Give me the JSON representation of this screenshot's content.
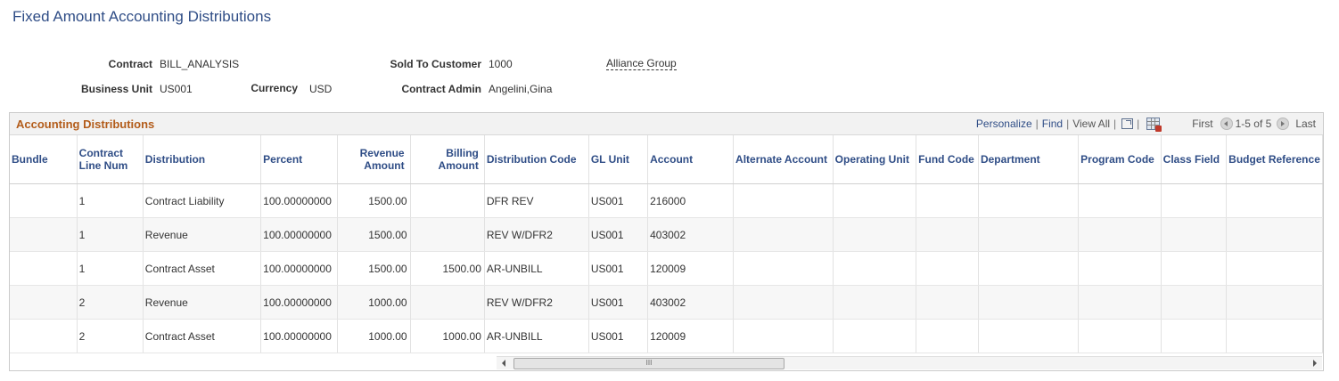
{
  "page": {
    "title": "Fixed Amount Accounting Distributions"
  },
  "header": {
    "contract_label": "Contract",
    "contract_value": "BILL_ANALYSIS",
    "sold_to_label": "Sold To Customer",
    "sold_to_value": "1000",
    "sold_to_name": "Alliance Group",
    "bu_label": "Business Unit",
    "bu_value": "US001",
    "currency_label": "Currency",
    "currency_value": "USD",
    "admin_label": "Contract Admin",
    "admin_value": "Angelini,Gina"
  },
  "grid": {
    "title": "Accounting Distributions",
    "tools": {
      "personalize": "Personalize",
      "find": "Find",
      "view_all": "View All",
      "first": "First",
      "range": "1-5 of 5",
      "last": "Last",
      "sep": "|"
    },
    "columns": {
      "bundle": "Bundle",
      "line": "Contract Line Num",
      "distribution": "Distribution",
      "percent": "Percent",
      "revenue": "Revenue Amount",
      "billing": "Billing Amount",
      "dist_code": "Distribution Code",
      "gl_unit": "GL Unit",
      "account": "Account",
      "alt_account": "Alternate Account",
      "oper_unit": "Operating Unit",
      "fund": "Fund Code",
      "department": "Department",
      "program": "Program Code",
      "class": "Class Field",
      "budget": "Budget Reference"
    },
    "rows": [
      {
        "bundle": "",
        "line": "1",
        "distribution": "Contract Liability",
        "percent": "100.00000000",
        "revenue": "1500.00",
        "billing": "",
        "dist_code": "DFR REV",
        "gl_unit": "US001",
        "account": "216000"
      },
      {
        "bundle": "",
        "line": "1",
        "distribution": "Revenue",
        "percent": "100.00000000",
        "revenue": "1500.00",
        "billing": "",
        "dist_code": "REV W/DFR2",
        "gl_unit": "US001",
        "account": "403002"
      },
      {
        "bundle": "",
        "line": "1",
        "distribution": "Contract Asset",
        "percent": "100.00000000",
        "revenue": "1500.00",
        "billing": "1500.00",
        "dist_code": "AR-UNBILL",
        "gl_unit": "US001",
        "account": "120009"
      },
      {
        "bundle": "",
        "line": "2",
        "distribution": "Revenue",
        "percent": "100.00000000",
        "revenue": "1000.00",
        "billing": "",
        "dist_code": "REV W/DFR2",
        "gl_unit": "US001",
        "account": "403002"
      },
      {
        "bundle": "",
        "line": "2",
        "distribution": "Contract Asset",
        "percent": "100.00000000",
        "revenue": "1000.00",
        "billing": "1000.00",
        "dist_code": "AR-UNBILL",
        "gl_unit": "US001",
        "account": "120009"
      }
    ],
    "scrollbar_grip": "III"
  }
}
